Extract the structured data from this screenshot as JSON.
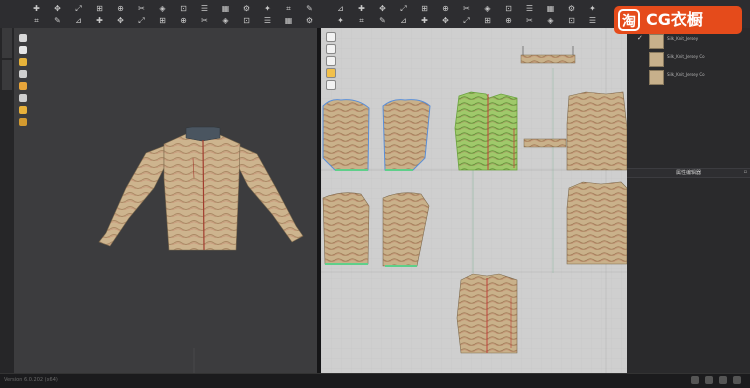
{
  "brand": {
    "logo_glyph": "淘",
    "text": "CG衣橱",
    "color": "#e54b1b"
  },
  "fabrics": [
    {
      "label": "Silk_Knit_Jersey",
      "checked": true
    },
    {
      "label": "Silk_Knit_Jersey Co",
      "checked": false
    },
    {
      "label": "Silk_Knit_Jersey Co",
      "checked": false
    }
  ],
  "property_editor_title": "属性编辑器",
  "status_text": "Version 6.0.202 (x64)",
  "colors": {
    "fabric": "#c7b08b",
    "fabric_line": "#b6926e",
    "seam_red": "#b84a3a",
    "selected_green": "#8cc75a",
    "outline_blue": "#5a8fd8",
    "grid_bg": "#cfcfcf",
    "viewport_bg": "#3c3c3e"
  },
  "icons": {
    "toolbar": [
      "select-icon",
      "move-icon",
      "transform-icon",
      "fold-icon",
      "pin-icon",
      "sewing-icon",
      "simulate-icon",
      "measure-icon",
      "avatar-icon",
      "fabric-icon",
      "button-icon",
      "zipper-icon",
      "texture-icon",
      "brush-icon",
      "ruler-icon"
    ],
    "view3d_tools": [
      "sim-icon",
      "avatar-icon",
      "pose-icon",
      "fabric-display-icon",
      "texture-icon",
      "mannequin-icon",
      "color-icon"
    ],
    "view2d_tools": [
      "select-pattern-icon",
      "edit-pattern-icon",
      "point-icon",
      "curve-icon",
      "seam-icon"
    ]
  }
}
